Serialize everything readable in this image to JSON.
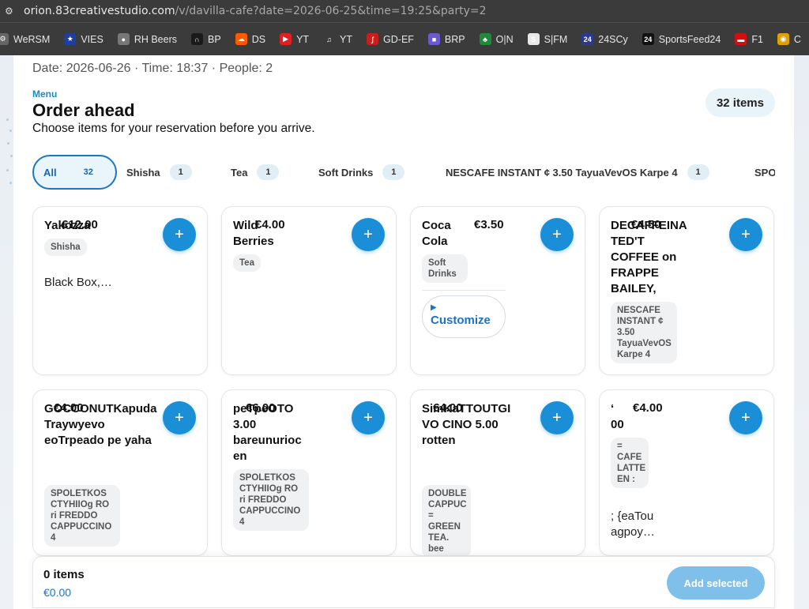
{
  "browser": {
    "url_host": "orion.83creativestudio.com",
    "url_path": "/v/davilla-cafe?date=2026-06-25&time=19:25&party=2",
    "bookmarks": [
      {
        "label": "WeRSM",
        "icon": "werism-icon",
        "color": "#666"
      },
      {
        "label": "VIES",
        "icon": "eu-flag-icon",
        "color": "#1f3fa0"
      },
      {
        "label": "RH Beers",
        "icon": "beer-icon",
        "color": "#777"
      },
      {
        "label": "BP",
        "icon": "headphones-icon",
        "color": "#1a1a1a"
      },
      {
        "label": "DS",
        "icon": "soundcloud-icon",
        "color": "#ff5a00"
      },
      {
        "label": "YT",
        "icon": "youtube-icon",
        "color": "#e02020"
      },
      {
        "label": "YT",
        "icon": "music-note-icon",
        "color": "#3b3b3b"
      },
      {
        "label": "GD-EF",
        "icon": "feather-icon",
        "color": "#c81e1e"
      },
      {
        "label": "BRP",
        "icon": "square-icon",
        "color": "#6a5acd"
      },
      {
        "label": "O|N",
        "icon": "clover-icon",
        "color": "#1e8a3a"
      },
      {
        "label": "S|FM",
        "icon": "sfm-icon",
        "color": "#e8e8e8"
      },
      {
        "label": "24SCy",
        "icon": "24scy-icon",
        "color": "#2a3a8c"
      },
      {
        "label": "SportsFeed24",
        "icon": "sportsfeed-icon",
        "color": "#111"
      },
      {
        "label": "F1",
        "icon": "f1-icon",
        "color": "#d01010"
      },
      {
        "label": "C",
        "icon": "chrome-icon",
        "color": "#e0a000"
      }
    ]
  },
  "header": {
    "meta": "Date: 2026-06-26 · Time: 18:37 · People: 2",
    "eyebrow": "Menu",
    "title": "Order ahead",
    "subtitle": "Choose items for your reservation before you arrive.",
    "item_count": "32 items"
  },
  "tabs": [
    {
      "label": "All",
      "count": "32",
      "active": true
    },
    {
      "label": "Shisha",
      "count": "1"
    },
    {
      "label": "Tea",
      "count": "1"
    },
    {
      "label": "Soft Drinks",
      "count": "1"
    },
    {
      "label": "NESCAFE INSTANT ¢ 3.50 TayuaVevOS Karpe 4",
      "count": "1"
    },
    {
      "label": "SPO",
      "count": ""
    }
  ],
  "products": [
    {
      "name": "Yakozza",
      "price": "€12.00",
      "tag": "Shisha",
      "desc": "Black Box,…",
      "add": "+"
    },
    {
      "name": "Wild Berries",
      "price": "€4.00",
      "tag": "Tea",
      "desc": "",
      "add": "+"
    },
    {
      "name": "Coca Cola",
      "price": "€3.50",
      "tag": "Soft Drinks",
      "desc": "",
      "add": "+",
      "customize": "Customize"
    },
    {
      "name": "DECAFFEINATED'T COFFEE on FRAPPE BAILEY,",
      "price": "€4.50",
      "tag": "NESCAFE INSTANT ¢ 3.50 TayuaVevOS Karpe 4",
      "desc": "",
      "add": "+"
    },
    {
      "name": "GOCCONUTKapuda Traywyevo eoTrpeado pe yaha",
      "price": "€4.00",
      "tag": "SPOLETKOS CTYHIIOg RO ri FREDDO CAPPUCCINO 4",
      "desc": "",
      "add": "+"
    },
    {
      "name": "peTpeOTO 3.00 bareunurioc en",
      "price": "€6.00",
      "tag": "SPOLETKOS CTYHIIOg RO ri FREDDO CAPPUCCINO 4",
      "desc": "",
      "add": "+"
    },
    {
      "name": "SimKaTTOUTGIVO CINO 5.00 rotten",
      "price": "€4.00",
      "tag": "DOUBLE CAPPUC = GREEN TEA. bee",
      "desc": "",
      "add": "+"
    },
    {
      "name": "‘ 00",
      "price": "€4.00",
      "tag": "= CAFE LATTE EN :",
      "desc": "; {eaTou agpoy…",
      "add": "+"
    }
  ],
  "cart": {
    "quantity": "0 items",
    "total": "€0.00",
    "add_selected": "Add selected"
  },
  "colors": {
    "accent": "#1a8fd8",
    "accent_disabled": "#7ec0ea",
    "link": "#1a73c6",
    "chrome": "#3b3b3b"
  }
}
